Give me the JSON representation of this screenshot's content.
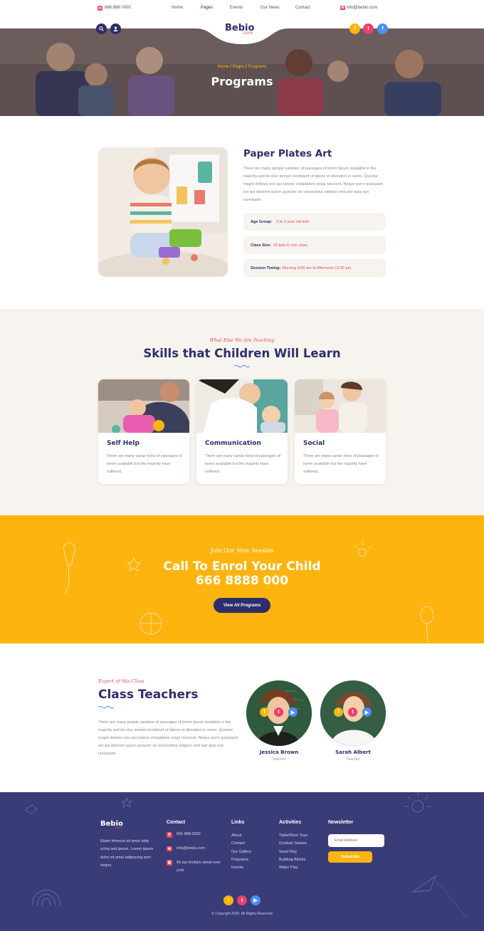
{
  "topbar": {
    "phone": "666 888 0000",
    "email": "info@bebio.com",
    "nav": [
      "Home",
      "Pages",
      "Events",
      "Our News",
      "Contact"
    ]
  },
  "logo": {
    "main": "Bebio",
    "sub": "care"
  },
  "hero": {
    "breadcrumb": [
      "Home",
      "Pages",
      "Programs"
    ],
    "title": "Programs"
  },
  "program": {
    "title": "Paper Plates Art",
    "text": "There are many people variation of passages of lorem Ipsum available in the majority sed do eius tempor incididunt ut labore et alteration in some. Quuntur magni dolores eos qui ratione voluptatem sequi nesciunt. Neque porro quisquam est qui dolorem ipsum quiaolor sit consectetur adipisci velit sed quia non numquam.",
    "details": [
      {
        "label": "Age Group:",
        "value": "2 to 3 year old kids"
      },
      {
        "label": "Class Size:",
        "value": "20 kids in one class"
      },
      {
        "label": "Session Timing:",
        "value": "Morning 9:00 am to Afternoon 12:30 pm"
      }
    ]
  },
  "skills": {
    "kicker": "What Else We Are Teaching",
    "title": "Skills that Children Will Learn",
    "cards": [
      {
        "title": "Self Help",
        "text": "There are many varian tions of passages of lorem available but the majority have suffered."
      },
      {
        "title": "Communication",
        "text": "There are many varian tions of passages of lorem available but the majority have suffered."
      },
      {
        "title": "Social",
        "text": "There are many varian tions of passages of lorem available but the majority have suffered."
      }
    ]
  },
  "enrol": {
    "kicker": "Join Our New Session",
    "title": "Call To Enrol Your Child",
    "phone": "666 8888 000",
    "button": "View All Programs"
  },
  "teachers": {
    "kicker": "Expert of this Class",
    "title": "Class Teachers",
    "text": "There are many people variation of passages of lorem Ipsum available in the majority sed do eius tempor incididunt ut labore et alteration in some. Quuntur magni dolores eos qui ratione voluptatem sequi nesciunt. Neque porro quisquam est qui dolorem ipsum quiaolor sit consectetur adipisci velit sed quia non numquam.",
    "people": [
      {
        "name": "Jessica Brown",
        "role": "Teacher"
      },
      {
        "name": "Sarah Albert",
        "role": "Teacher"
      }
    ]
  },
  "footer": {
    "about": "Etiam rhoncus sit amet adip scing sed ipsum. Lorem ipsum dolor sit amet adipiscing sem neque.",
    "contact_title": "Contact",
    "contact": {
      "phone": "666 888 0000",
      "email": "info@bebio.com",
      "address": "66 top broklyn street new york"
    },
    "links_title": "Links",
    "links": [
      "About",
      "Contact",
      "Our Gallery",
      "Programs",
      "Events"
    ],
    "activities_title": "Activities",
    "activities": [
      "Table/Floor Toys",
      "Outdoor Games",
      "Sand Play",
      "Building Blocks",
      "Water Play"
    ],
    "newsletter_title": "Newsletter",
    "email_placeholder": "Email Address",
    "subscribe": "Subscribe",
    "copyright": "© Copyright 2020. All Rights Reserved"
  },
  "social_icons": [
    "facebook-icon",
    "twitter-icon",
    "youtube-icon"
  ],
  "colors": {
    "navy": "#2d2e6b",
    "pink": "#e8455c",
    "yellow": "#fdb40f",
    "footer": "#3a3c78",
    "cream": "#f7f3ee",
    "twitter": "#ef3f6f",
    "blue": "#4a8ff0"
  }
}
